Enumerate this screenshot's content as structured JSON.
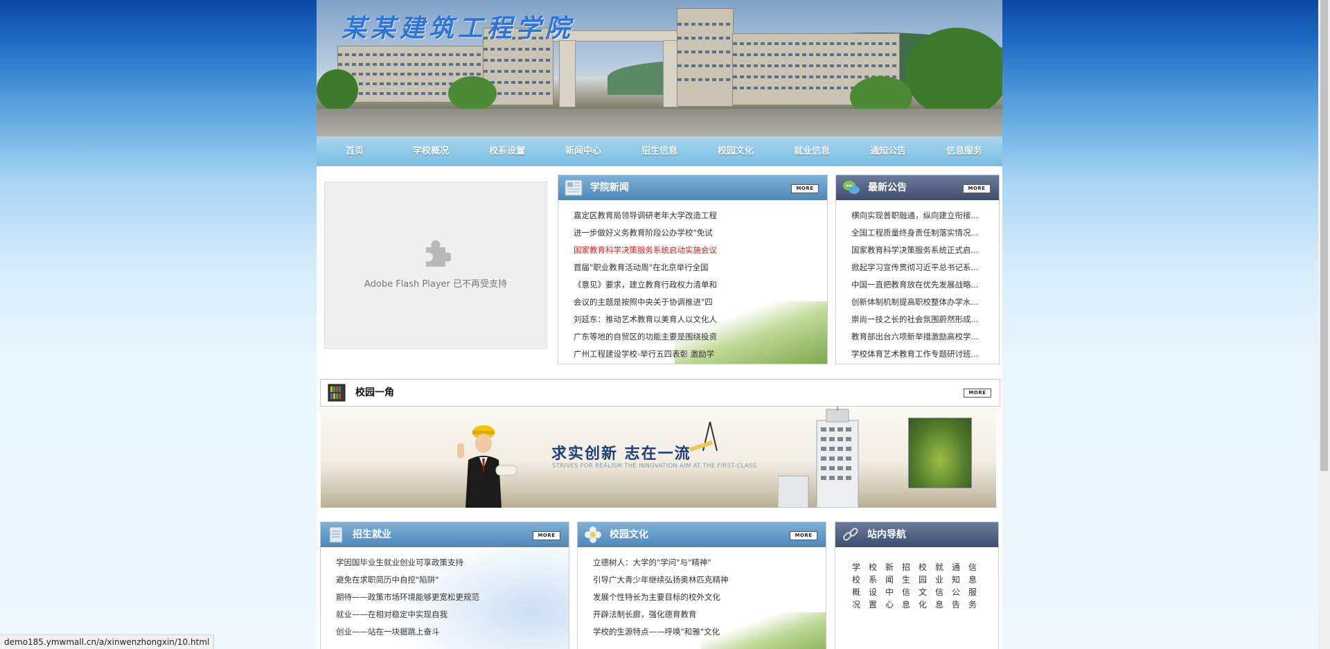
{
  "banner": {
    "school_name": "某某建筑工程学院"
  },
  "nav": {
    "items": [
      "首页",
      "学校概况",
      "校系设置",
      "新闻中心",
      "招生信息",
      "校园文化",
      "就业信息",
      "通知公告",
      "信息服务"
    ]
  },
  "flash": {
    "message": "Adobe Flash Player 已不再受支持"
  },
  "more_label": "MORE",
  "news": {
    "title": "学院新闻",
    "items": [
      {
        "text": "嘉定区教育局领导调研老年大学改造工程",
        "highlight": false
      },
      {
        "text": "进一步做好义务教育阶段公办学校\"免试",
        "highlight": false
      },
      {
        "text": "国家教育科学决策服务系统启动实施会议",
        "highlight": true
      },
      {
        "text": "首届\"职业教育活动周\"在北京举行全国",
        "highlight": false
      },
      {
        "text": "《意见》要求，建立教育行政权力清单和",
        "highlight": false
      },
      {
        "text": "会议的主题是按照中央关于协调推进\"四",
        "highlight": false
      },
      {
        "text": "刘延东：推动艺术教育以美育人以文化人",
        "highlight": false
      },
      {
        "text": "广东等地的自贸区的功能主要是围绕投资",
        "highlight": false
      },
      {
        "text": "广州工程建设学校-举行五四表彰 激励学",
        "highlight": false
      }
    ]
  },
  "notice": {
    "title": "最新公告",
    "items": [
      "横向实现普职融通，纵向建立衔接...",
      "全国工程质量终身责任制落实情况...",
      "国家教育科学决策服务系统正式启...",
      "掀起学习宣传贯彻习近平总书记系...",
      "中国一直把教育放在优先发展战略...",
      "创新体制机制提高职校整体办学水...",
      "崇尚一技之长的社会氛围蔚然形成...",
      "教育部出台六项新举措激励高校学...",
      "学校体育艺术教育工作专题研讨班..."
    ]
  },
  "corner": {
    "title": "校园一角"
  },
  "promo": {
    "slogan": "求实创新  志在一流",
    "subtitle": "STRIVES FOR REALISM THE INNOVATION AIM AT THE FIRST-CLASS"
  },
  "admission": {
    "title": "招生就业",
    "items": [
      "学因国毕业生就业创业可享政策支持",
      "避免在求职简历中自挖\"陷阱\"",
      "期待——政策市场环境能够更宽松更规范",
      "就业——在相对稳定中实现自我",
      "创业——站在一块据跳上奋斗"
    ]
  },
  "culture": {
    "title": "校园文化",
    "items": [
      "立德树人：大学的\"学问\"与\"精神\"",
      "引导广大青少年继续弘扬奥林匹克精神",
      "发展个性特长为主要目标的校外文化",
      "开辟法制长廊，强化德育教育",
      "学校的生源特点——呼唤\"和雅\"文化"
    ]
  },
  "sitenav": {
    "title": "站内导航",
    "columns": [
      "学校概况",
      "校系设置",
      "新闻中心",
      "招生信息",
      "校园文化",
      "就业信息",
      "通知公告",
      "信息服务"
    ]
  },
  "status_url": "demo185.ymwmall.cn/a/xinwenzhongxin/10.html"
}
